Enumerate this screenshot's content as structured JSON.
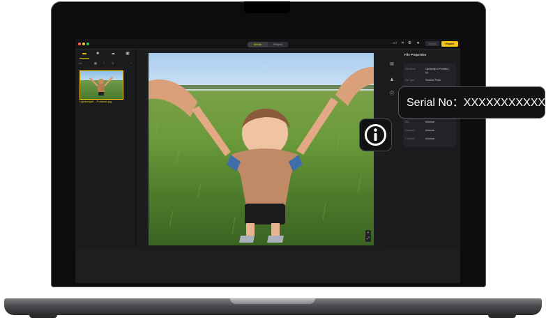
{
  "window": {
    "traffic_lights": [
      "#ff5f57",
      "#febc2e",
      "#28c840"
    ]
  },
  "toolbar": {
    "mode_tabs": [
      {
        "label": "Media"
      },
      {
        "label": "Project"
      }
    ],
    "share_label": "Share",
    "export_label": "Export"
  },
  "left_panel": {
    "filter_label": "All",
    "thumbnail_filename": "Lightweight ...Portable.jpg"
  },
  "properties": {
    "title": "File Properties",
    "rows": [
      {
        "label": "File Name",
        "value": "Lightweight & Portable.j"
      },
      {
        "label": "",
        "value": "pg"
      },
      {
        "label": "File Type",
        "value": "Standard Photo"
      },
      {
        "label": "ISO",
        "value": "Unknown"
      },
      {
        "label": "Exposure",
        "value": "Unknown"
      },
      {
        "label": "F-number",
        "value": "Unknown"
      }
    ]
  },
  "callout": {
    "serial_text": "Serial No：XXXXXXXXXXX"
  },
  "colors": {
    "accent": "#f5c518",
    "app_bg": "#1b1c1e"
  }
}
